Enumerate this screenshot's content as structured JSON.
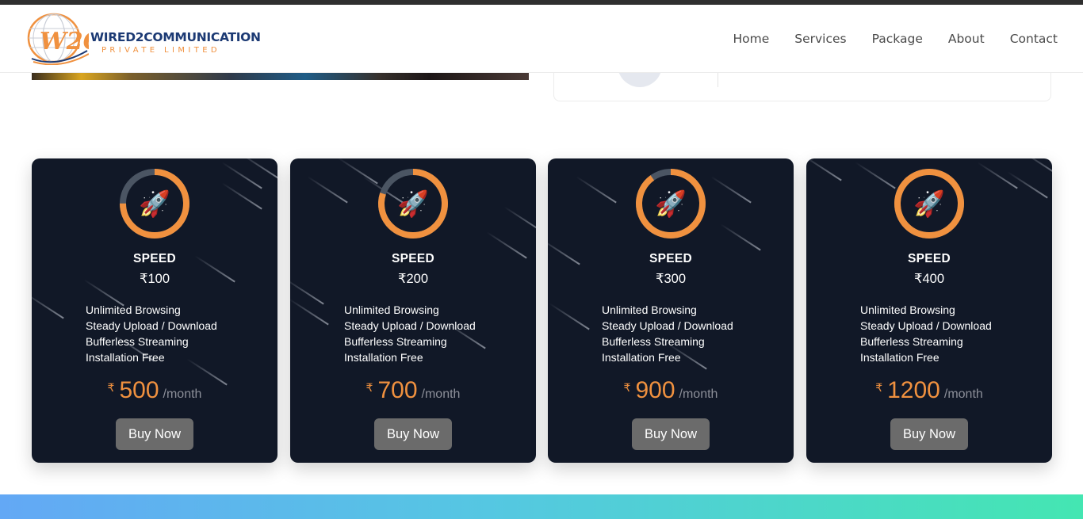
{
  "brand": {
    "name": "WIRED2COMMUNICATION",
    "tagline": "PRIVATE LIMITED",
    "logo_mark": "W2C",
    "colors": {
      "navy": "#1c3a74",
      "orange": "#f0913f"
    }
  },
  "nav": {
    "items": [
      {
        "label": "Home"
      },
      {
        "label": "Services"
      },
      {
        "label": "Package"
      },
      {
        "label": "About"
      },
      {
        "label": "Contact"
      }
    ]
  },
  "theme": {
    "card_background": "#111827",
    "accent": "#f0913f",
    "gauge_track": "#4b5563",
    "button_background": "#6b6b6b",
    "footer_gradient": [
      "#63a8f5",
      "#44e6b2"
    ]
  },
  "plans": [
    {
      "icon": "rocket-icon",
      "speed_label": "SPEED",
      "speed_value": "₹100",
      "gauge_fraction": 0.75,
      "features": [
        "Unlimited Browsing",
        "Steady Upload / Download",
        "Bufferless Streaming",
        "Installation Free"
      ],
      "currency": "₹",
      "price": "500",
      "period": "/month",
      "button_label": "Buy Now"
    },
    {
      "icon": "rocket-icon",
      "speed_label": "SPEED",
      "speed_value": "₹200",
      "gauge_fraction": 0.8,
      "features": [
        "Unlimited Browsing",
        "Steady Upload / Download",
        "Bufferless Streaming",
        "Installation Free"
      ],
      "currency": "₹",
      "price": "700",
      "period": "/month",
      "button_label": "Buy Now"
    },
    {
      "icon": "rocket-icon",
      "speed_label": "SPEED",
      "speed_value": "₹300",
      "gauge_fraction": 0.9,
      "features": [
        "Unlimited Browsing",
        "Steady Upload / Download",
        "Bufferless Streaming",
        "Installation Free"
      ],
      "currency": "₹",
      "price": "900",
      "period": "/month",
      "button_label": "Buy Now"
    },
    {
      "icon": "rocket-icon",
      "speed_label": "SPEED",
      "speed_value": "₹400",
      "gauge_fraction": 1.0,
      "features": [
        "Unlimited Browsing",
        "Steady Upload / Download",
        "Bufferless Streaming",
        "Installation Free"
      ],
      "currency": "₹",
      "price": "1200",
      "period": "/month",
      "button_label": "Buy Now"
    }
  ]
}
